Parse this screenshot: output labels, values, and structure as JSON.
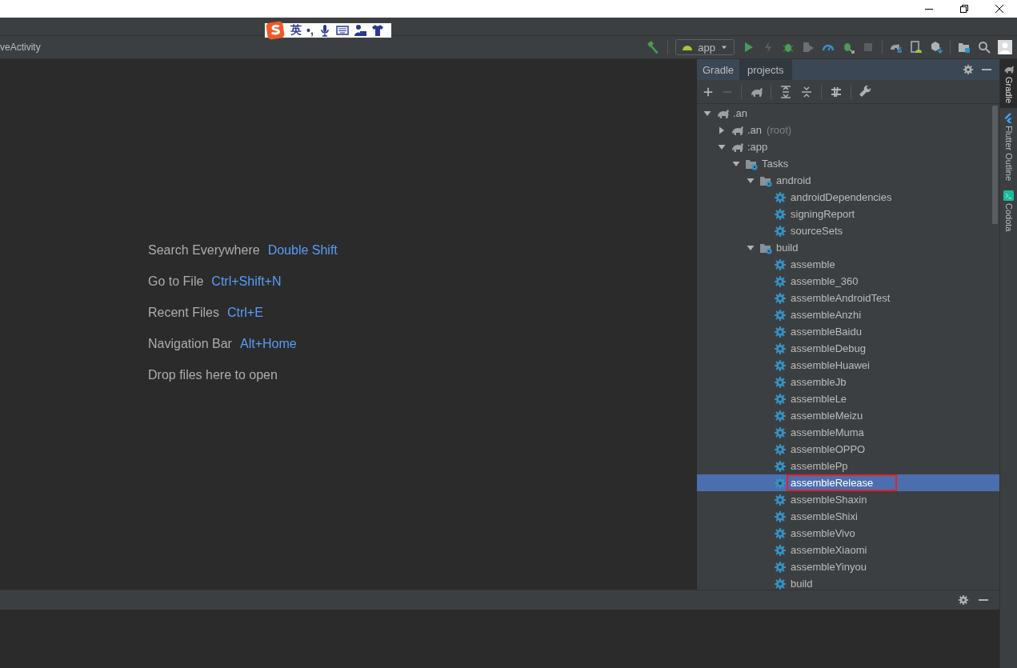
{
  "ime_toolbar": {
    "mode": "英",
    "punct": "•,"
  },
  "navigation": {
    "breadcrumb": "veActivity"
  },
  "run_config": {
    "label": "app"
  },
  "welcome": {
    "hints": [
      {
        "label": "Search Everywhere",
        "shortcut": "Double Shift"
      },
      {
        "label": "Go to File",
        "shortcut": "Ctrl+Shift+N"
      },
      {
        "label": "Recent Files",
        "shortcut": "Ctrl+E"
      },
      {
        "label": "Navigation Bar",
        "shortcut": "Alt+Home"
      },
      {
        "label": "Drop files here to open"
      }
    ]
  },
  "gradle_panel": {
    "title": "Gradle",
    "tab": "projects",
    "tree": [
      {
        "kind": "project",
        "name": ".an",
        "expanded": true,
        "selected": false,
        "children": [
          {
            "kind": "project",
            "name": ".an",
            "suffix": "(root)",
            "expanded": false,
            "selected": false
          },
          {
            "kind": "project",
            "name": ":app",
            "expanded": true,
            "selected": false,
            "children": [
              {
                "kind": "folder",
                "name": "Tasks",
                "expanded": true,
                "selected": false,
                "children": [
                  {
                    "kind": "folder",
                    "name": "android",
                    "expanded": true,
                    "selected": false,
                    "children": [
                      {
                        "kind": "task",
                        "name": "androidDependencies",
                        "selected": false,
                        "outlined": false
                      },
                      {
                        "kind": "task",
                        "name": "signingReport",
                        "selected": false,
                        "outlined": false
                      },
                      {
                        "kind": "task",
                        "name": "sourceSets",
                        "selected": false,
                        "outlined": false
                      }
                    ]
                  },
                  {
                    "kind": "folder",
                    "name": "build",
                    "expanded": true,
                    "selected": false,
                    "children": [
                      {
                        "kind": "task",
                        "name": "assemble",
                        "selected": false,
                        "outlined": false
                      },
                      {
                        "kind": "task",
                        "name": "assemble_360",
                        "selected": false,
                        "outlined": false
                      },
                      {
                        "kind": "task",
                        "name": "assembleAndroidTest",
                        "selected": false,
                        "outlined": false
                      },
                      {
                        "kind": "task",
                        "name": "assembleAnzhi",
                        "selected": false,
                        "outlined": false
                      },
                      {
                        "kind": "task",
                        "name": "assembleBaidu",
                        "selected": false,
                        "outlined": false
                      },
                      {
                        "kind": "task",
                        "name": "assembleDebug",
                        "selected": false,
                        "outlined": false
                      },
                      {
                        "kind": "task",
                        "name": "assembleHuawei",
                        "selected": false,
                        "outlined": false
                      },
                      {
                        "kind": "task",
                        "name": "assembleJb",
                        "selected": false,
                        "outlined": false
                      },
                      {
                        "kind": "task",
                        "name": "assembleLe",
                        "selected": false,
                        "outlined": false
                      },
                      {
                        "kind": "task",
                        "name": "assembleMeizu",
                        "selected": false,
                        "outlined": false
                      },
                      {
                        "kind": "task",
                        "name": "assembleMuma",
                        "selected": false,
                        "outlined": false
                      },
                      {
                        "kind": "task",
                        "name": "assembleOPPO",
                        "selected": false,
                        "outlined": false
                      },
                      {
                        "kind": "task",
                        "name": "assemblePp",
                        "selected": false,
                        "outlined": false
                      },
                      {
                        "kind": "task",
                        "name": "assembleRelease",
                        "selected": true,
                        "outlined": true
                      },
                      {
                        "kind": "task",
                        "name": "assembleShaxin",
                        "selected": false,
                        "outlined": false
                      },
                      {
                        "kind": "task",
                        "name": "assembleShixi",
                        "selected": false,
                        "outlined": false
                      },
                      {
                        "kind": "task",
                        "name": "assembleVivo",
                        "selected": false,
                        "outlined": false
                      },
                      {
                        "kind": "task",
                        "name": "assembleXiaomi",
                        "selected": false,
                        "outlined": false
                      },
                      {
                        "kind": "task",
                        "name": "assembleYinyou",
                        "selected": false,
                        "outlined": false
                      },
                      {
                        "kind": "task",
                        "name": "build",
                        "selected": false,
                        "outlined": false
                      }
                    ]
                  }
                ]
              }
            ]
          }
        ]
      }
    ]
  },
  "side_tabs": [
    {
      "label": "Gradle",
      "selected": true
    },
    {
      "label": "Flutter Outline",
      "selected": false
    },
    {
      "label": "Codota",
      "selected": false
    }
  ]
}
